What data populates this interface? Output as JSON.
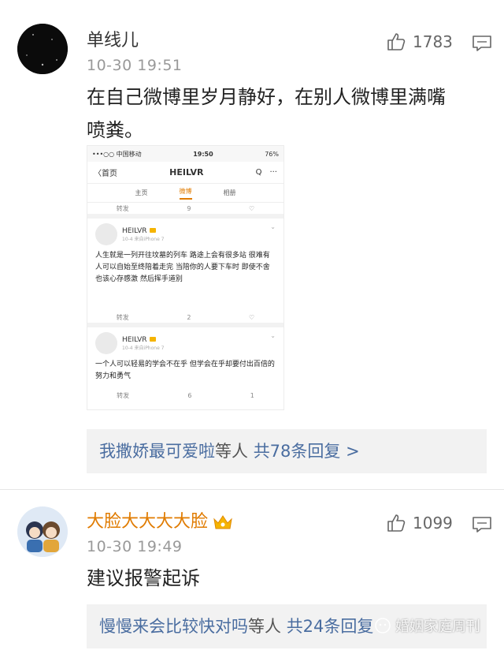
{
  "comments": [
    {
      "user": "单线儿",
      "time": "10-30 19:51",
      "likes": "1783",
      "text_line1": "在自己微博里岁月静好，在别人微博里满嘴",
      "text_line2": "喷粪。",
      "replies": {
        "who": "我撒娇最可爱啦",
        "mid": "等人",
        "count": "共78条回复 >"
      }
    },
    {
      "user": "大脸大大大大脸",
      "time": "10-30 19:49",
      "likes": "1099",
      "text_line1": "建议报警起诉",
      "replies": {
        "who": "慢慢来会比较快对吗",
        "mid": "等人",
        "count": "共24条回复"
      }
    }
  ],
  "embed": {
    "status_left": "•••○○ 中国移动",
    "status_time": "19:50",
    "status_right": "76%",
    "back": "〈首页",
    "title": "HEILVR",
    "search": "Q",
    "more": "···",
    "tabs": [
      "主页",
      "微博",
      "相册"
    ],
    "top_actions": [
      "转发",
      "9",
      ""
    ],
    "posts": [
      {
        "name": "HEILVR",
        "meta": "10-4 来自iPhone 7",
        "text": "人生就是一列开往坟墓的列车 路途上会有很多站 很难有人可以自始至终陪着走完 当陪你的人要下车时 即使不舍也该心存感激 然后挥手道别",
        "actions": [
          "转发",
          "2",
          ""
        ]
      },
      {
        "name": "HEILVR",
        "meta": "10-4 来自iPhone 7",
        "text": "一个人可以轻易的学会不在乎 但学会在乎却要付出百倍的努力和勇气",
        "actions": [
          "转发",
          "6",
          "1"
        ]
      }
    ]
  },
  "watermark": "婚姻家庭周刊"
}
